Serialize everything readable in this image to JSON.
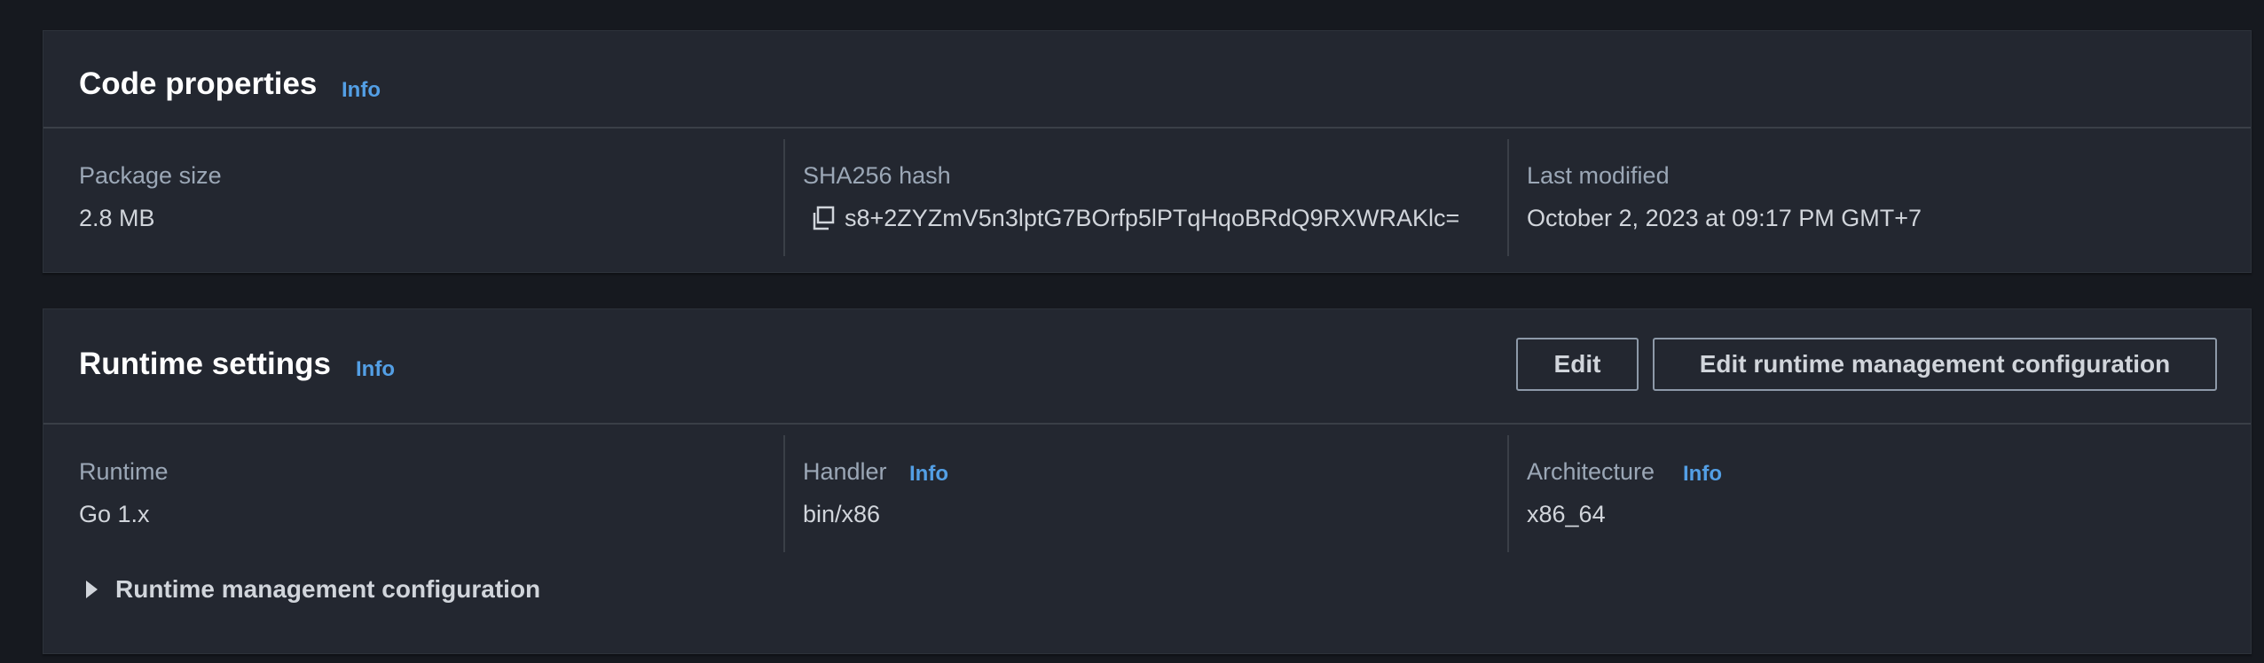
{
  "code_properties": {
    "title": "Code properties",
    "info": "Info",
    "package_size": {
      "label": "Package size",
      "value": "2.8 MB"
    },
    "sha256": {
      "label": "SHA256 hash",
      "value": "s8+2ZYZmV5n3lptG7BOrfp5lPTqHqoBRdQ9RXWRAKlc=",
      "icon": "copy-icon"
    },
    "last_modified": {
      "label": "Last modified",
      "value": "October 2, 2023 at 09:17 PM GMT+7"
    }
  },
  "runtime_settings": {
    "title": "Runtime settings",
    "info": "Info",
    "edit_label": "Edit",
    "edit_runtime_label": "Edit runtime management configuration",
    "runtime": {
      "label": "Runtime",
      "value": "Go 1.x"
    },
    "handler": {
      "label": "Handler",
      "info": "Info",
      "value": "bin/x86"
    },
    "architecture": {
      "label": "Architecture",
      "info": "Info",
      "value": "x86_64"
    },
    "expander_label": "Runtime management configuration",
    "expander_icon": "caret-right-icon"
  },
  "colors": {
    "background": "#16191f",
    "panel": "#232730",
    "info_link": "#539fe5",
    "label": "#9ba7b6",
    "text": "#d1d5db"
  }
}
